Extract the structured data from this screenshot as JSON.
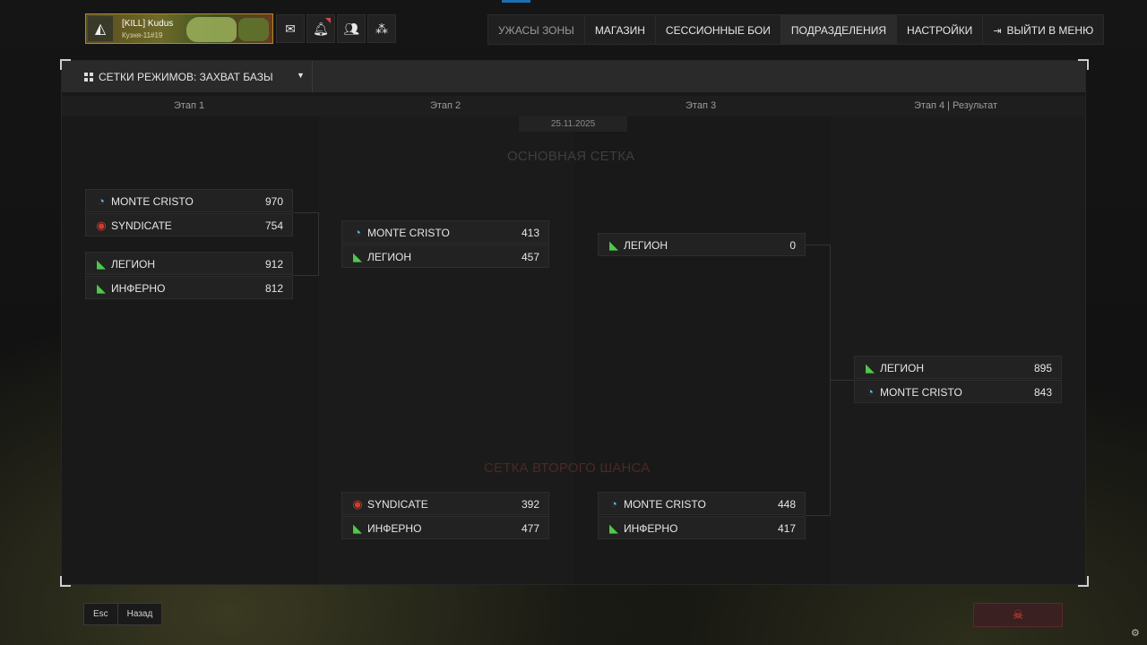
{
  "profile": {
    "name": "[KILL] Kudus",
    "sub": "Кузня-11#19"
  },
  "header_icons": [
    "mail-icon",
    "bell-icon",
    "friends-icon",
    "clan-icon"
  ],
  "menu": {
    "items": [
      {
        "label": "УЖАСЫ ЗОНЫ"
      },
      {
        "label": "МАГАЗИН"
      },
      {
        "label": "СЕССИОННЫЕ БОИ"
      },
      {
        "label": "ПОДРАЗДЕЛЕНИЯ"
      },
      {
        "label": "НАСТРОЙКИ"
      },
      {
        "label": "ВЫЙТИ В МЕНЮ"
      }
    ],
    "active": "ПОДРАЗДЕЛЕНИЯ"
  },
  "mode_selector": {
    "label": "СЕТКИ РЕЖИМОВ: ЗАХВАТ БАЗЫ"
  },
  "stages": [
    "Этап 1",
    "Этап 2",
    "Этап 3",
    "Этап 4 | Результат"
  ],
  "date": "25.11.2025",
  "main_bracket_title": "ОСНОВНАЯ СЕТКА",
  "second_bracket_title": "СЕТКА ВТОРОГО ШАНСА",
  "team_colors": {
    "monte": "#5fb8e0",
    "syndicate": "#d33a2c",
    "legion": "#4ec94a",
    "inferno": "#4ec94a"
  },
  "matches": {
    "s1m1": [
      {
        "team": "MONTE CRISTO",
        "score": "970"
      },
      {
        "team": "SYNDICATE",
        "score": "754"
      }
    ],
    "s1m2": [
      {
        "team": "ЛЕГИОН",
        "score": "912"
      },
      {
        "team": "ИНФЕРНО",
        "score": "812"
      }
    ],
    "s2m1": [
      {
        "team": "MONTE CRISTO",
        "score": "413"
      },
      {
        "team": "ЛЕГИОН",
        "score": "457"
      }
    ],
    "s3m1": [
      {
        "team": "ЛЕГИОН",
        "score": "0"
      }
    ],
    "s4m1": [
      {
        "team": "ЛЕГИОН",
        "score": "895"
      },
      {
        "team": "MONTE CRISTO",
        "score": "843"
      }
    ],
    "l2m1": [
      {
        "team": "SYNDICATE",
        "score": "392"
      },
      {
        "team": "ИНФЕРНО",
        "score": "477"
      }
    ],
    "l3m1": [
      {
        "team": "MONTE CRISTO",
        "score": "448"
      },
      {
        "team": "ИНФЕРНО",
        "score": "417"
      }
    ]
  },
  "bottom": {
    "esc_key": "Esc",
    "back_label": "Назад"
  }
}
